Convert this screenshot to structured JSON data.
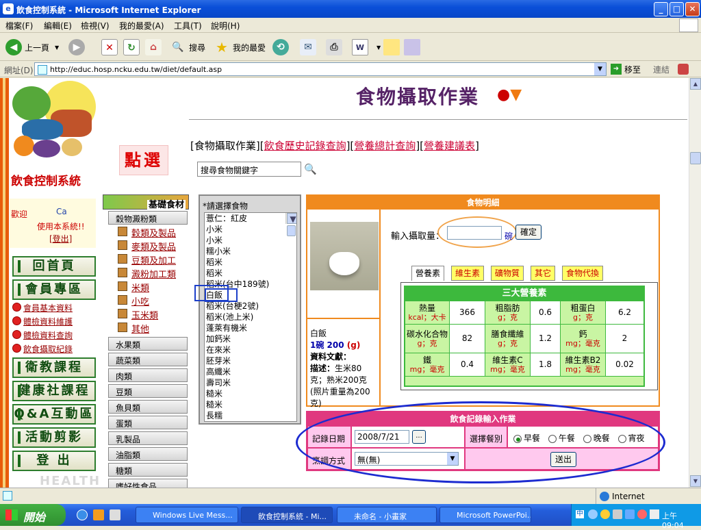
{
  "window": {
    "title": "飲食控制系統 - Microsoft Internet Explorer",
    "min": "_",
    "max": "□",
    "close": "✕"
  },
  "menu": [
    "檔案(F)",
    "編輯(E)",
    "檢視(V)",
    "我的最愛(A)",
    "工具(T)",
    "說明(H)"
  ],
  "toolbar": {
    "back": "上一頁",
    "search": "搜尋",
    "favorites": "我的最愛"
  },
  "address": {
    "label": "網址(D)",
    "url": "http://educ.hosp.ncku.edu.tw/diet/default.asp",
    "go": "移至",
    "links": "連結"
  },
  "sidebar": {
    "logo_text": "飲食控制系統",
    "welcome": "歡迎",
    "user": "Ca",
    "greeting": "使用本系統!!",
    "logout": "[登出]",
    "nav": [
      "回首頁",
      "會員專區",
      "衛教課程",
      "健康社課程",
      "Q&A互動區",
      "活動剪影",
      "登 出"
    ],
    "member_links": [
      "會員基本資料",
      "體檢資料維護",
      "體檢資料查詢",
      "飲食攝取紀錄"
    ],
    "health": "HEALTH"
  },
  "main": {
    "title": "食物攝取作業",
    "tabs_nav": {
      "pre": "[食物攝取作業][",
      "l1": "飲食歷史記錄查詢",
      "m1": "][",
      "l2": "營養總計查詢",
      "m2": "][",
      "l3": "營養建議表",
      "post": "]"
    },
    "point_select": "點選",
    "search_placeholder": "搜尋食物關鍵字",
    "category_header": "基礎食材",
    "categories": [
      "穀物澱粉類",
      "水果類",
      "蔬菜類",
      "肉類",
      "豆類",
      "魚貝類",
      "蛋類",
      "乳製品",
      "油脂類",
      "糖類",
      "嗜好性食品"
    ],
    "grain_subs": [
      "穀類及製品",
      "麥類及製品",
      "豆類及加工",
      "澱粉加工類",
      "米類",
      "小吃",
      "玉米類",
      "其他"
    ],
    "food_select_label": "*請選擇食物",
    "foods": [
      "薏仁：紅皮",
      "小米",
      "小米",
      "糯小米",
      "稻米",
      "稻米",
      "稻米(台中189號)",
      "白飯",
      "稻米(台梗2號)",
      "稻米(池上米)",
      "蓬萊有機米",
      "加鈣米",
      "在來米",
      "胚芽米",
      "高纖米",
      "壽司米",
      "糙米",
      "糙米",
      "長糯"
    ]
  },
  "detail": {
    "header": "食物明細",
    "intake_label": "輸入攝取量：",
    "unit": "碗",
    "confirm": "確定",
    "food_name": "白飯",
    "amount_prefix": "1碗",
    "amount_value": "200",
    "amount_unit": "(g)",
    "source_label": "資料文獻：",
    "desc_label": "描述：",
    "desc_value": "生米80克；熟米200克 (照片重量為200克)",
    "tabs": [
      "營養素",
      "維生素",
      "礦物質",
      "其它",
      "食物代換"
    ],
    "nut_header": "三大營養素",
    "nutrients": [
      {
        "name": "熱量",
        "unit": "kcal；大卡",
        "value": "366"
      },
      {
        "name": "粗脂肪",
        "unit": "g；克",
        "value": "0.6"
      },
      {
        "name": "粗蛋白",
        "unit": "g；克",
        "value": "6.2"
      },
      {
        "name": "碳水化合物",
        "unit": "g；克",
        "value": "82"
      },
      {
        "name": "膳食纖維",
        "unit": "g；克",
        "value": "1.2"
      },
      {
        "name": "鈣",
        "unit": "mg；毫克",
        "value": "2"
      },
      {
        "name": "鐵",
        "unit": "mg；毫克",
        "value": "0.4"
      },
      {
        "name": "維生素C",
        "unit": "mg；毫克",
        "value": "1.8"
      },
      {
        "name": "維生素B2",
        "unit": "mg；毫克",
        "value": "0.02"
      }
    ]
  },
  "record": {
    "header": "飲食記錄輸入作業",
    "date_label": "記錄日期",
    "date_value": "2008/7/21",
    "date_btn": "...",
    "meal_label": "選擇餐別",
    "meals": [
      "早餐",
      "午餐",
      "晚餐",
      "宵夜"
    ],
    "selected_meal": "早餐",
    "cook_label": "烹調方式",
    "cook_value": "無(無)",
    "submit": "送出"
  },
  "status": {
    "zone": "Internet"
  },
  "taskbar": {
    "start": "開始",
    "tasks": [
      "Windows Live Mess...",
      "飲食控制系統 - Mi...",
      "未命名 - 小畫家",
      "Microsoft PowerPoi..."
    ],
    "time": "上午 09:04"
  }
}
